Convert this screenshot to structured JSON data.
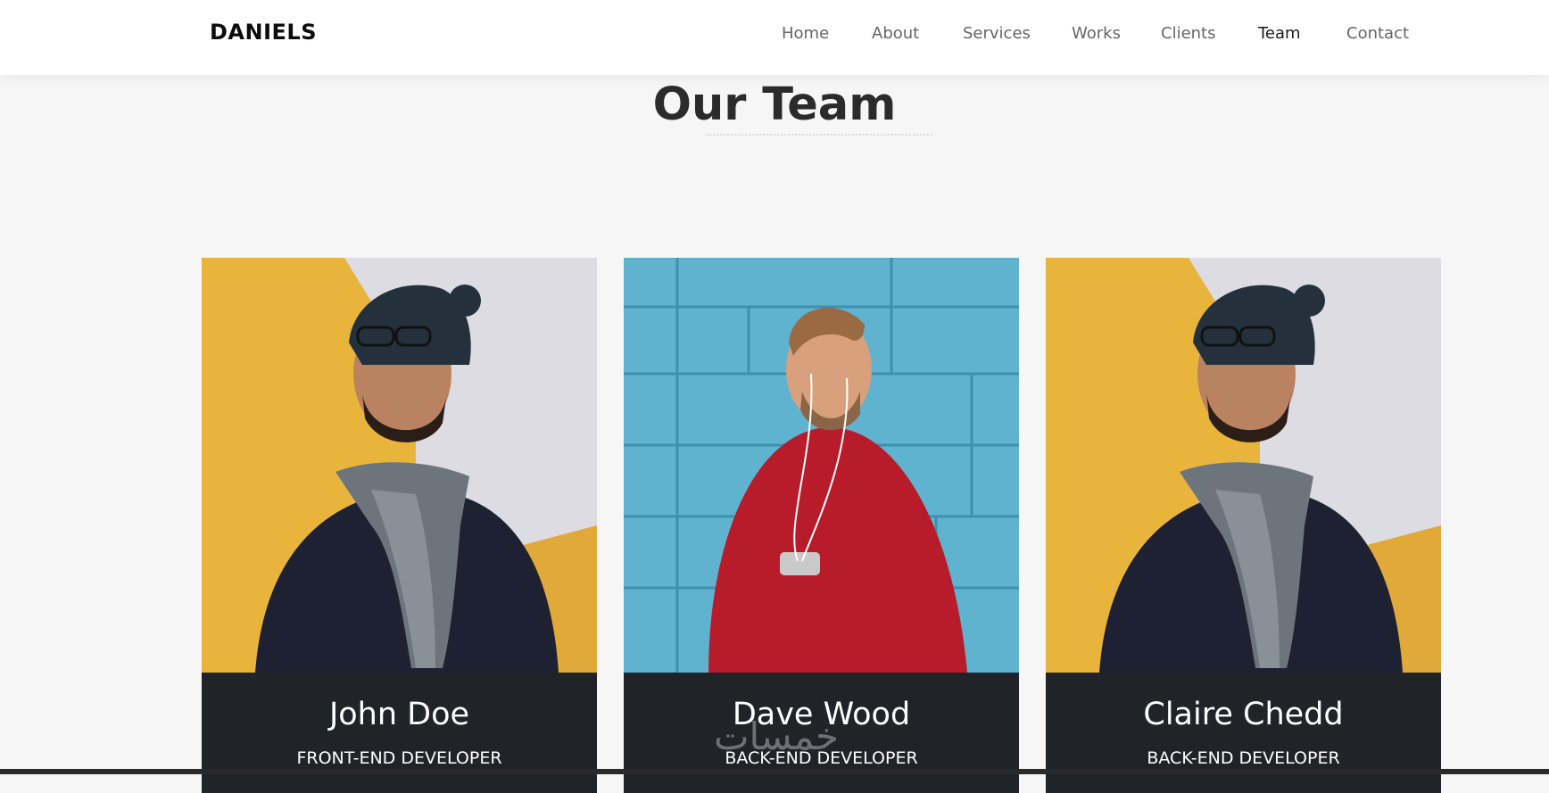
{
  "header": {
    "brand": "DANIELS",
    "nav": [
      {
        "label": "Home",
        "active": false
      },
      {
        "label": "About",
        "active": false
      },
      {
        "label": "Services",
        "active": false
      },
      {
        "label": "Works",
        "active": false
      },
      {
        "label": "Clients",
        "active": false
      },
      {
        "label": "Team",
        "active": true
      },
      {
        "label": "Contact",
        "active": false
      }
    ]
  },
  "team": {
    "title": "Our Team",
    "members": [
      {
        "name": "John Doe",
        "role": "FRONT-END DEVELOPER",
        "photo": "man-beanie-scarf-photo"
      },
      {
        "name": "Dave Wood",
        "role": "BACK-END DEVELOPER",
        "photo": "man-red-sweater-photo"
      },
      {
        "name": "Claire Chedd",
        "role": "BACK-END DEVELOPER",
        "photo": "man-beanie-scarf-photo"
      }
    ]
  },
  "watermark": {
    "text": "خمسات"
  },
  "colors": {
    "nav_bg": "#ffffff",
    "page_bg": "#f6f6f6",
    "card_bg": "#202328",
    "accent_yellow": "#e9b43c",
    "wall_blue": "#5fb3cf",
    "sweater_red": "#b81c2b"
  }
}
